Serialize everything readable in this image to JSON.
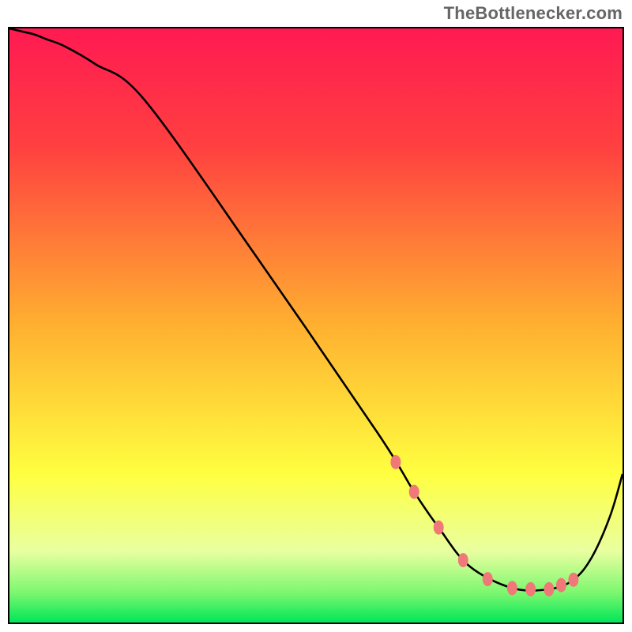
{
  "attribution": {
    "site": "TheBottlenecker.com"
  },
  "chart_data": {
    "type": "line",
    "title": "",
    "xlabel": "",
    "ylabel": "",
    "xlim": [
      0,
      100
    ],
    "ylim": [
      0,
      100
    ],
    "grid": false,
    "legend": false,
    "background_gradient": {
      "stops": [
        {
          "offset": 0,
          "color": "#ff1a52"
        },
        {
          "offset": 20,
          "color": "#ff4040"
        },
        {
          "offset": 50,
          "color": "#ffb030"
        },
        {
          "offset": 75,
          "color": "#ffff40"
        },
        {
          "offset": 88,
          "color": "#e9ffa0"
        },
        {
          "offset": 95,
          "color": "#7cf76f"
        },
        {
          "offset": 100,
          "color": "#00e658"
        }
      ]
    },
    "series": [
      {
        "name": "bottleneck-curve",
        "color": "#000000",
        "x": [
          0,
          2,
          4,
          6,
          9,
          14,
          22,
          40,
          60,
          66,
          70,
          75,
          82,
          88,
          92,
          95,
          98,
          100
        ],
        "y": [
          100,
          99.5,
          99,
          98.2,
          97,
          94,
          88,
          62,
          32,
          22,
          16,
          9.5,
          5.8,
          5.6,
          7.2,
          11,
          18,
          25
        ]
      }
    ],
    "markers": {
      "name": "dotted-segment",
      "color": "#f07878",
      "x": [
        63,
        66,
        70,
        74,
        78,
        82,
        85,
        88,
        90,
        92
      ],
      "y": [
        27,
        22,
        16,
        10.5,
        7.3,
        5.8,
        5.6,
        5.6,
        6.3,
        7.2
      ]
    }
  }
}
